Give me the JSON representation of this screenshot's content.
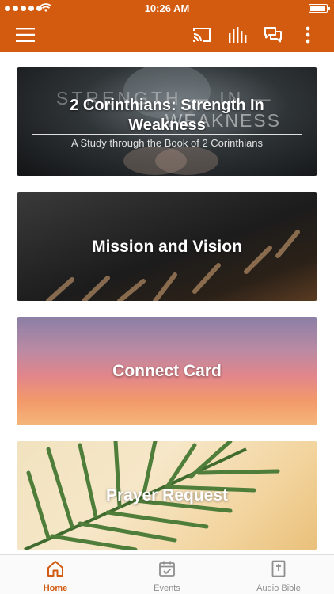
{
  "status_bar": {
    "time": "10:26 AM"
  },
  "nav": {
    "icons": [
      "menu-icon",
      "cast-icon",
      "audio-bars-icon",
      "chat-icon",
      "more-vertical-icon"
    ]
  },
  "colors": {
    "accent": "#d35b10",
    "tab_inactive": "#8e8e8e"
  },
  "cards": [
    {
      "background_text_top": "STRENGTH — IN —",
      "background_text_bottom": "WEAKNESS",
      "title": "2 Corinthians: Strength In Weakness",
      "subtitle": "A Study through the Book of 2 Corinthians"
    },
    {
      "title": "Mission and Vision"
    },
    {
      "title": "Connect Card"
    },
    {
      "title": "Prayer Request"
    }
  ],
  "tabs": [
    {
      "label": "Home",
      "icon": "home-icon",
      "active": true
    },
    {
      "label": "Events",
      "icon": "calendar-check-icon",
      "active": false
    },
    {
      "label": "Audio Bible",
      "icon": "bible-icon",
      "active": false
    }
  ]
}
